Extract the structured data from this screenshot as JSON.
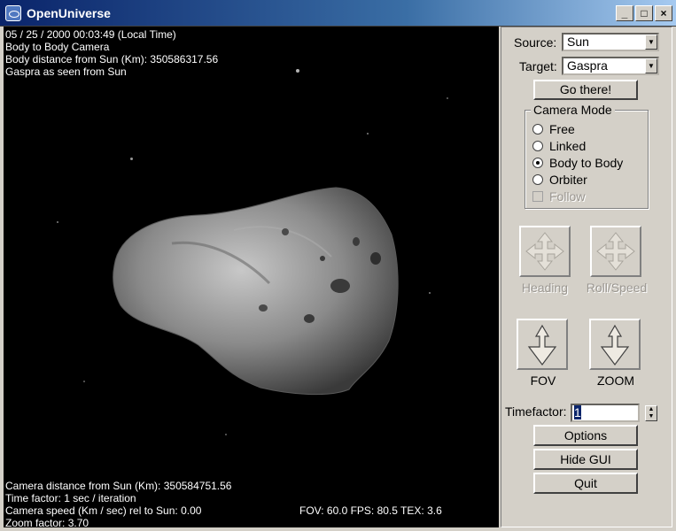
{
  "window": {
    "title": "OpenUniverse",
    "minimize_glyph": "_",
    "maximize_glyph": "□",
    "close_glyph": "×"
  },
  "hud": {
    "top_lines": [
      "05 / 25 / 2000  00:03:49 (Local Time)",
      "Body to Body Camera",
      "Body distance from Sun (Km): 350586317.56",
      "Gaspra as seen from Sun"
    ],
    "bottom_lines": [
      "Camera distance from Sun (Km): 350584751.56",
      "Time factor: 1 sec / iteration",
      "Camera speed (Km / sec) rel to Sun: 0.00",
      "Zoom factor: 3.70"
    ],
    "stats": "FOV: 60.0  FPS: 80.5 TEX: 3.6"
  },
  "panel": {
    "source_label": "Source:",
    "source_value": "Sun",
    "target_label": "Target:",
    "target_value": "Gaspra",
    "go_button": "Go there!",
    "camera_mode_title": "Camera Mode",
    "modes": [
      "Free",
      "Linked",
      "Body to Body",
      "Orbiter"
    ],
    "selected_mode": "Body to Body",
    "follow_label": "Follow",
    "heading_label": "Heading",
    "roll_speed_label": "Roll/Speed",
    "fov_label": "FOV",
    "zoom_label": "ZOOM",
    "timefactor_label": "Timefactor:",
    "timefactor_value": "1",
    "options_button": "Options",
    "hide_gui_button": "Hide GUI",
    "quit_button": "Quit"
  },
  "colors": {
    "title_gradient_start": "#0a246a",
    "panel_bg": "#d4d0c8",
    "viewport_bg": "#000000",
    "hud_text": "#ffffff"
  }
}
